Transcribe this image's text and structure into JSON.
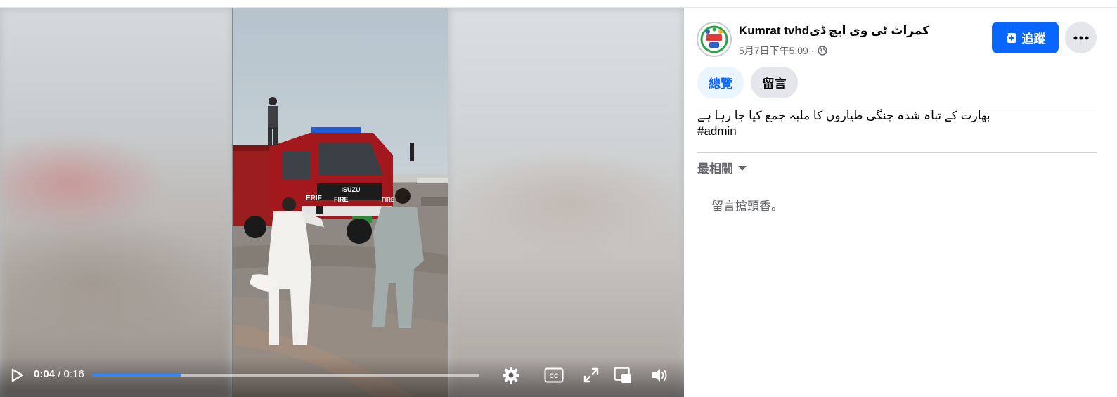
{
  "video": {
    "current_time": "0:04",
    "separator": " / ",
    "duration": "0:16",
    "progress_fraction": 0.23,
    "truck_texts": {
      "brand": "ISUZU",
      "fire_front": "FIRE",
      "fire_mirror": "ERIF",
      "fire_side": "FIRE"
    },
    "controls": {
      "play_icon": "play-icon",
      "settings_icon": "gear-icon",
      "captions_icon": "cc-icon",
      "fullscreen_icon": "expand-icon",
      "pip_icon": "picture-in-picture-icon",
      "volume_icon": "volume-icon"
    }
  },
  "post": {
    "page_name": "Kumrat tvhdکمراٹ ٹی وی ایچ ڈی",
    "date": "5月7日下午5:09",
    "meta_separator": "·",
    "privacy_icon": "globe-icon",
    "follow_label": "追蹤",
    "follow_icon": "follow-page-icon",
    "more_icon": "more-dots-icon",
    "tabs": [
      {
        "label": "總覽",
        "active": true
      },
      {
        "label": "留言",
        "active": false
      }
    ],
    "caption": "بھارت کے تباہ شدہ جنگی طیاروں کا ملبہ جمع کیا جا رہا ہے",
    "hashtag": "#admin"
  },
  "comments": {
    "sort_label": "最相關",
    "sort_icon": "caret-down-icon",
    "empty_text": "留言搶頭香。"
  },
  "colors": {
    "accent": "#0866ff",
    "progress": "#2d88ff",
    "secondary_text": "#65676b",
    "button_gray": "#e4e6eb"
  }
}
